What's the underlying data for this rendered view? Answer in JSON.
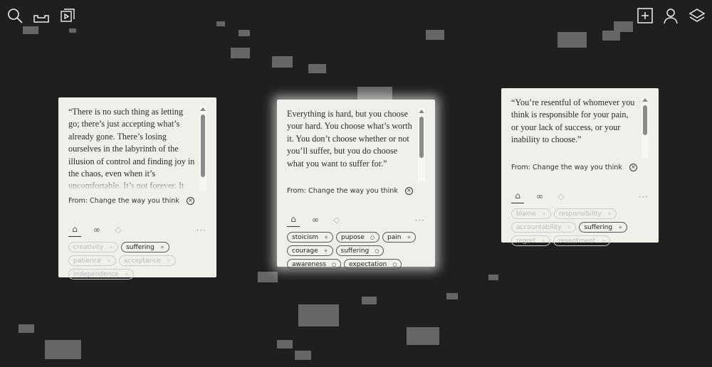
{
  "toolbar_left": [
    {
      "icon": "search-icon"
    },
    {
      "icon": "inbox-icon"
    },
    {
      "icon": "media-library-icon"
    }
  ],
  "toolbar_right": [
    {
      "icon": "add-icon"
    },
    {
      "icon": "user-icon"
    },
    {
      "icon": "layers-icon"
    }
  ],
  "cards": [
    {
      "quote": "“There is no such thing as letting go; there’s just accepting what’s already gone. There’s losing ourselves in the labyrinth of the illusion of control and finding joy in the chaos, even when it’s uncomfortable. It’s not forever. It only remains as long as",
      "from": "From: Change the way you think",
      "more": "···",
      "tags": [
        {
          "label": "creativity",
          "active": false,
          "icon": "sparkle"
        },
        {
          "label": "suffering",
          "active": true,
          "icon": "sparkle"
        },
        {
          "label": "patience",
          "active": false,
          "icon": "sparkle"
        },
        {
          "label": "acceptance",
          "active": false,
          "icon": "sparkle"
        },
        {
          "label": "independence",
          "active": false,
          "icon": "sparkle"
        }
      ]
    },
    {
      "quote": "Everything is hard, but you choose your hard. You choose what’s worth it. You don’t choose whether or not you’ll suffer, but you do choose what you want to suffer for.”",
      "from": "From: Change the way you think",
      "more": "···",
      "tags": [
        {
          "label": "stoicism",
          "active": true,
          "icon": "sparkle"
        },
        {
          "label": "pupose",
          "active": true,
          "icon": "circle"
        },
        {
          "label": "pain",
          "active": true,
          "icon": "sparkle"
        },
        {
          "label": "courage",
          "active": true,
          "icon": "sparkle"
        },
        {
          "label": "suffering",
          "active": true,
          "icon": "circle"
        },
        {
          "label": "awareness",
          "active": true,
          "icon": "circle"
        },
        {
          "label": "expectation",
          "active": true,
          "icon": "circle"
        }
      ]
    },
    {
      "quote": "“You’re resentful of whomever you think is responsible for your pain, or your lack of success, or your inability to choose.”",
      "from": "From: Change the way you think",
      "more": "···",
      "tags": [
        {
          "label": "blame",
          "active": false,
          "icon": "sparkle"
        },
        {
          "label": "responsibility",
          "active": false,
          "icon": "sparkle"
        },
        {
          "label": "accountability",
          "active": false,
          "icon": "sparkle"
        },
        {
          "label": "suffering",
          "active": true,
          "icon": "sparkle"
        },
        {
          "label": "regret",
          "active": false,
          "icon": "sparkle"
        },
        {
          "label": "resentment",
          "active": false,
          "icon": "sparkle"
        }
      ]
    }
  ]
}
